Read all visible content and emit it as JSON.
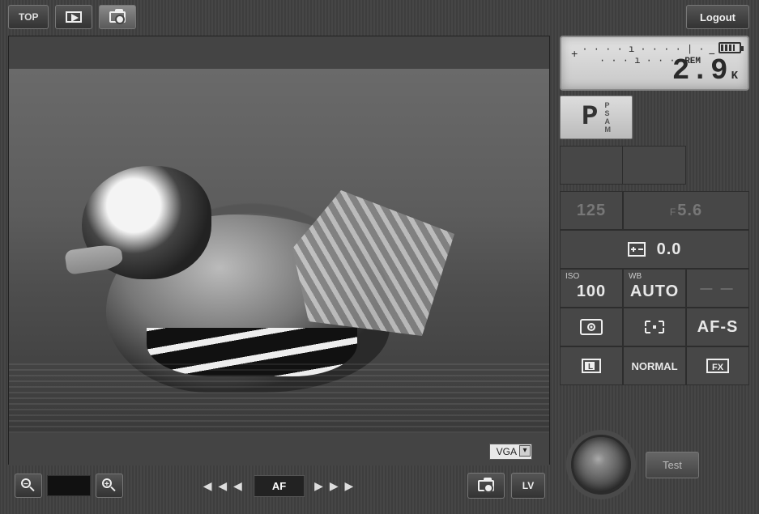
{
  "topbar": {
    "top_label": "TOP",
    "logout_label": "Logout"
  },
  "liveview": {
    "resolution_value": "VGA",
    "af_label": "AF",
    "arrows_left": "◀ ◀ ◀",
    "arrows_right": "▶ ▶ ▶",
    "lv_button": "LV"
  },
  "lcd": {
    "scale_plus": "+",
    "scale_ticks": "· · · · ı · · · · | · · · · ı · · · ·",
    "scale_minus": "−",
    "rem_label": "REM",
    "rem_value": "2.9",
    "rem_suffix": "K"
  },
  "mode": {
    "current": "P",
    "options": "P\nS\nA\nM"
  },
  "params": {
    "shutter": "125",
    "aperture_prefix": "F",
    "aperture": "5.6",
    "ev_label": "0.0",
    "iso_label": "ISO",
    "iso_value": "100",
    "wb_label": "WB",
    "wb_value": "AUTO",
    "flash_comp": "— —",
    "af_mode": "AF-S",
    "quality": "NORMAL",
    "image_area": "FX",
    "frame_size": "L"
  },
  "controls": {
    "test_label": "Test"
  }
}
